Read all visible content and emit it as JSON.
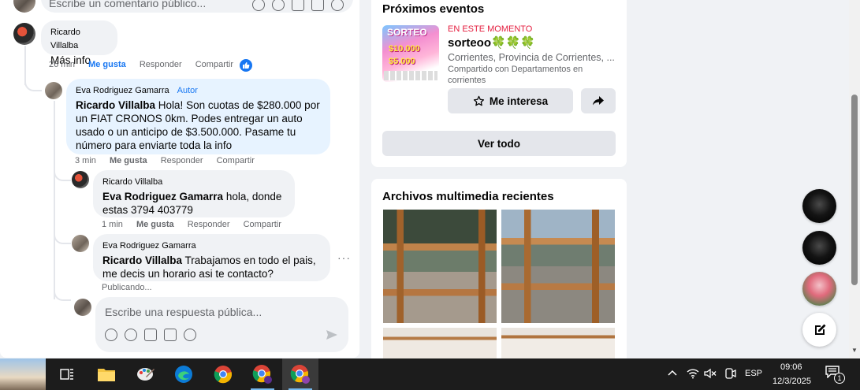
{
  "top_comment_box": {
    "placeholder": "Escribe un comentario público..."
  },
  "comments": [
    {
      "id": "c1",
      "author": "Ricardo Villalba",
      "text": "Más info",
      "time": "26 min",
      "like": "Me gusta",
      "reply": "Responder",
      "share": "Compartir"
    },
    {
      "id": "c2",
      "author": "Eva Rodriguez Gamarra",
      "badge": "Autor",
      "mention": "Ricardo Villalba",
      "text": " Hola! Son cuotas de $280.000 por un FIAT CRONOS 0km. Podes entregar un auto usado o un anticipo de $3.500.000. Pasame tu número para enviarte toda la info",
      "time": "3 min",
      "like": "Me gusta",
      "reply": "Responder",
      "share": "Compartir"
    },
    {
      "id": "c3",
      "author": "Ricardo Villalba",
      "mention": "Eva Rodriguez Gamarra",
      "text": " hola, donde estas 3794 403779",
      "time": "1 min",
      "like": "Me gusta",
      "reply": "Responder",
      "share": "Compartir"
    },
    {
      "id": "c4",
      "author": "Eva Rodriguez Gamarra",
      "mention": "Ricardo Villalba",
      "text": " Trabajamos en todo el pais, me decis un horario asi te contacto?",
      "status": "Publicando..."
    }
  ],
  "reply_box": {
    "placeholder": "Escribe una respuesta pública..."
  },
  "events": {
    "title": "Próximos eventos",
    "status": "EN ESTE MOMENTO",
    "name": "sorteoo🍀🍀🍀",
    "location": "Corrientes, Provincia de Corrientes, ...",
    "shared": "Compartido con Departamentos en corrientes",
    "interest_label": "Me interesa",
    "see_all": "Ver todo",
    "thumb_text": {
      "line1": "SORTEO",
      "line2": "$10.000",
      "line3": "$5.000"
    }
  },
  "media": {
    "title": "Archivos multimedia recientes"
  },
  "taskbar": {
    "language": "ESP",
    "time": "09:06",
    "date": "12/3/2025",
    "notifications": "1"
  },
  "colors": {
    "link_blue": "#1877f2",
    "event_red": "#e41e3f"
  }
}
